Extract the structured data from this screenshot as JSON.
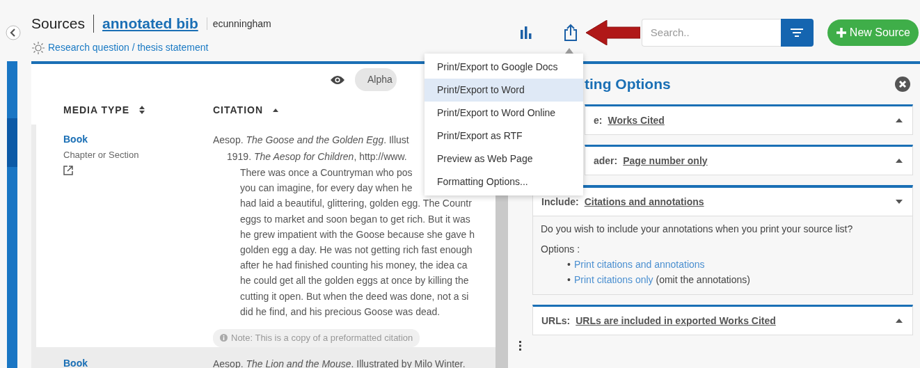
{
  "header": {
    "title": "Sources",
    "project": "annotated bib",
    "user": "ecunningham",
    "research_link": "Research question / thesis statement"
  },
  "toolbar": {
    "search_placeholder": "Search..",
    "new_source": "New Source",
    "export_menu_open": true
  },
  "export_menu": [
    {
      "label": "Print/Export to Google Docs",
      "selected": false
    },
    {
      "label": "Print/Export to Word",
      "selected": true
    },
    {
      "label": "Print/Export to Word Online",
      "selected": false
    },
    {
      "label": "Print/Export as RTF",
      "selected": false
    },
    {
      "label": "Preview as Web Page",
      "selected": false
    },
    {
      "label": "Formatting Options...",
      "selected": false
    }
  ],
  "view": {
    "sort_label": "Alpha"
  },
  "table": {
    "columns": [
      {
        "label": "MEDIA TYPE",
        "sorted": false
      },
      {
        "label": "CITATION",
        "sorted": true
      }
    ],
    "rows": [
      {
        "media_type": "Book",
        "subtype": "Chapter or Section",
        "citation_lines": [
          "Aesop. *The Goose and the Golden Egg*. Illust",
          "1919. *The Aesop for Children*, http://www."
        ],
        "annotation_lines": [
          "There was once a Countryman who pos",
          "you can imagine, for every day when he",
          "had laid a beautiful, glittering, golden egg. The Countr",
          "eggs to market and soon began to get rich. But it was",
          "he grew impatient with the Goose because she gave h",
          "golden egg a day. He was not getting rich fast enough",
          "after he had finished counting his money, the idea ca",
          "he could get all the golden eggs at once by killing the",
          "cutting it open. But when the deed was done, not a si",
          "did he find, and his precious Goose was dead."
        ],
        "note": "Note: This is a copy of a preformatted citation"
      },
      {
        "media_type": "Book",
        "citation_lines": [
          "Aesop. *The Lion and the Mouse*. Illustrated by Milo Winter."
        ]
      }
    ]
  },
  "panel": {
    "title": "ting Options",
    "sections": [
      {
        "label": "e:",
        "value": "Works Cited",
        "expanded": false
      },
      {
        "label": "ader:",
        "value": "Page number only",
        "expanded": false
      },
      {
        "label": "Include:",
        "value": "Citations and annotations",
        "expanded": true,
        "question": "Do you wish to include your annotations when you print your source list?",
        "options_label": "Options :",
        "options": [
          {
            "bullet": "•",
            "link": "Print citations and annotations"
          },
          {
            "bullet": "•",
            "link": "Print citations only",
            "note": "(omit the annotations)"
          }
        ]
      },
      {
        "label": "URLs:",
        "value": "URLs are included in exported Works Cited",
        "expanded": false
      }
    ]
  }
}
